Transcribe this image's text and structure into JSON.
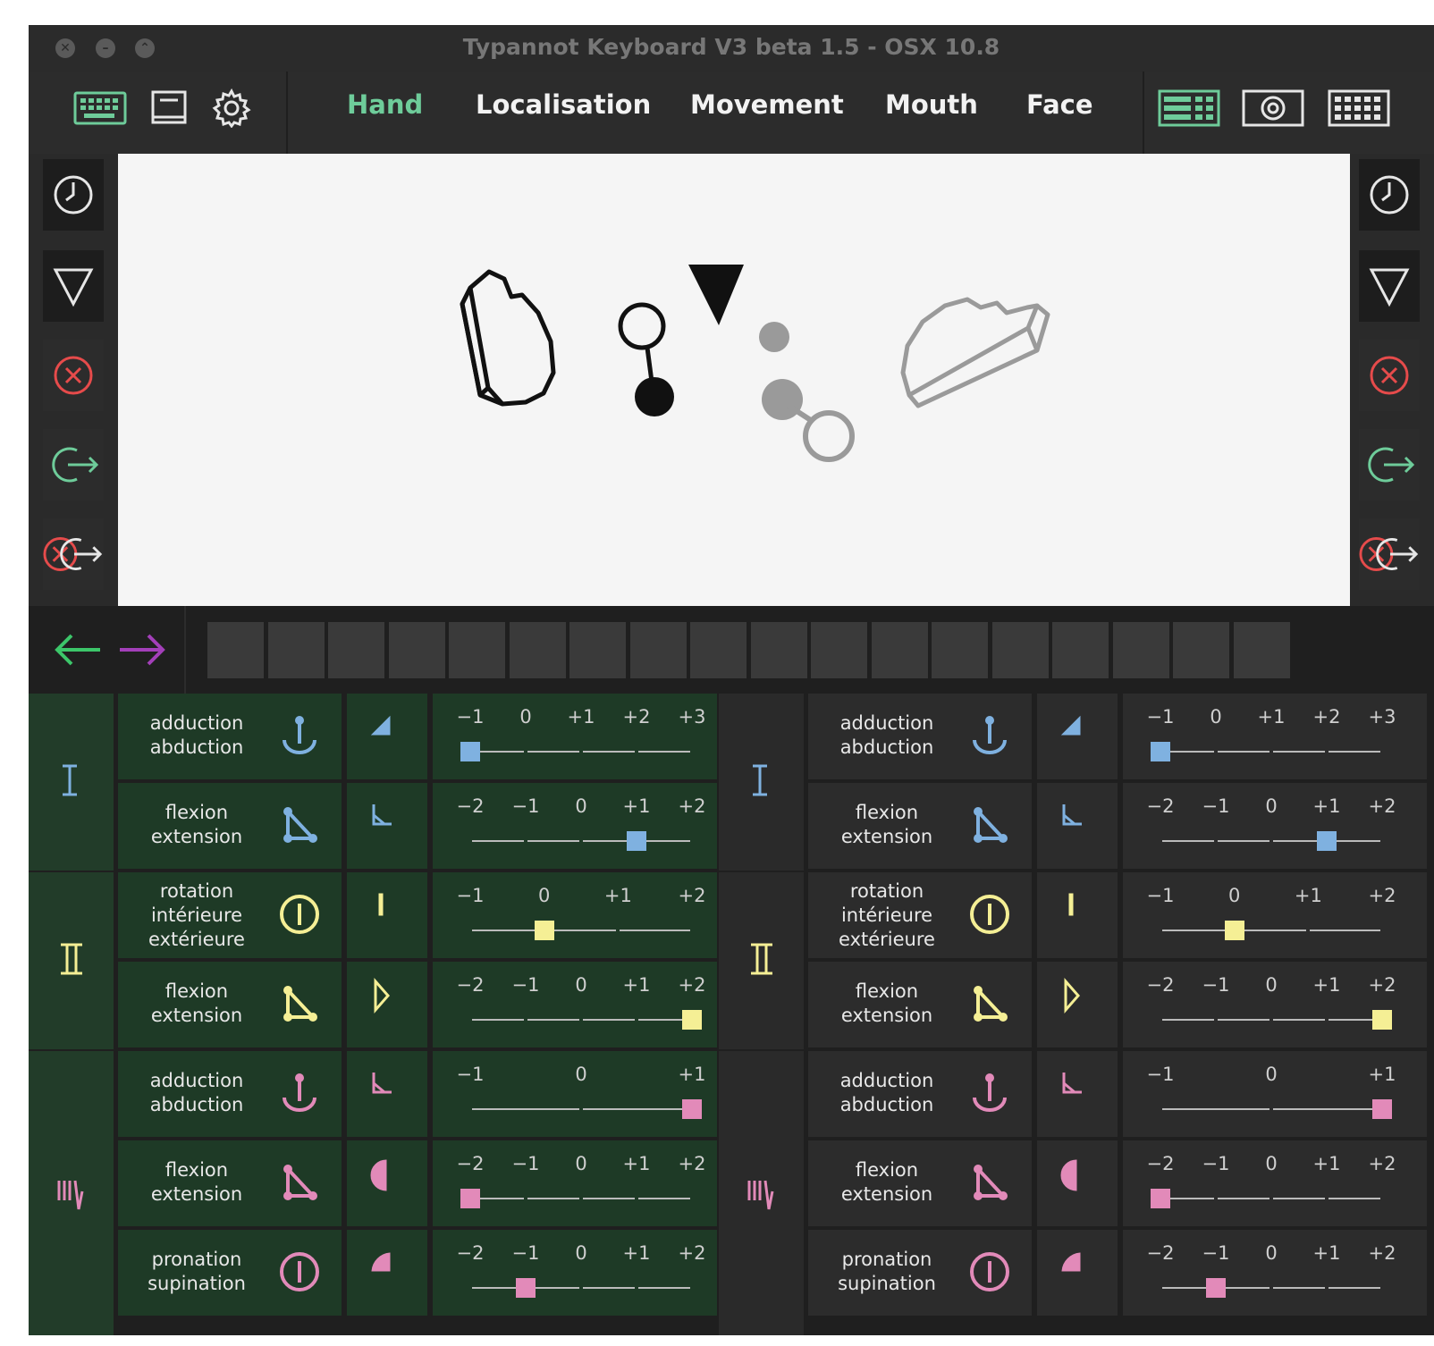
{
  "window": {
    "title": "Typannot Keyboard V3 beta 1.5 - OSX 10.8"
  },
  "traffic_lights": [
    {
      "name": "close",
      "glyph": "✕"
    },
    {
      "name": "minimize",
      "glyph": "–"
    },
    {
      "name": "zoom",
      "glyph": "⌃"
    }
  ],
  "toolbar": {
    "left_icons": [
      "keyboard-icon",
      "book-icon",
      "gear-icon"
    ],
    "tabs": [
      {
        "label": "Hand",
        "active": true
      },
      {
        "label": "Localisation",
        "active": false
      },
      {
        "label": "Movement",
        "active": false
      },
      {
        "label": "Mouth",
        "active": false
      },
      {
        "label": "Face",
        "active": false
      }
    ],
    "right_icons": [
      "layout-icon",
      "target-icon",
      "grid-keyboard-icon"
    ]
  },
  "side_buttons": [
    "clock-icon",
    "triangle-down-icon",
    "cancel-icon",
    "exit-icon",
    "cancel-exit-icon"
  ],
  "nav": {
    "back": "back-arrow-icon",
    "forward": "forward-arrow-icon",
    "sequence_slots": 18
  },
  "colors": {
    "accent": "#6ecc9a",
    "blue": "#7fb1e0",
    "yellow": "#f5ef95",
    "pink": "#e28ab9",
    "green_bg": "#223c29",
    "dark_bg": "#2a2a2a",
    "active_cell": "#1e3a26",
    "cell": "#2c2c2c"
  },
  "panels": [
    {
      "side": "left",
      "groups": [
        {
          "roman": "I",
          "rows": [
            {
              "label": [
                "adduction",
                "abduction"
              ],
              "color": "blue",
              "ticks": [
                "−1",
                "0",
                "+1",
                "+2",
                "+3"
              ],
              "value_index": 0
            },
            {
              "label": [
                "flexion",
                "extension"
              ],
              "color": "blue",
              "ticks": [
                "−2",
                "−1",
                "0",
                "+1",
                "+2"
              ],
              "value_index": 3
            }
          ]
        },
        {
          "roman": "II",
          "rows": [
            {
              "label": [
                "rotation",
                "intérieure",
                "extérieure"
              ],
              "color": "yellow",
              "ticks": [
                "−1",
                "0",
                "+1",
                "+2"
              ],
              "value_index": 1
            },
            {
              "label": [
                "flexion",
                "extension"
              ],
              "color": "yellow",
              "ticks": [
                "−2",
                "−1",
                "0",
                "+1",
                "+2"
              ],
              "value_index": 4
            }
          ]
        },
        {
          "roman": "III",
          "rows": [
            {
              "label": [
                "adduction",
                "abduction"
              ],
              "color": "pink",
              "ticks": [
                "−1",
                "0",
                "+1"
              ],
              "value_index": 2
            },
            {
              "label": [
                "flexion",
                "extension"
              ],
              "color": "pink",
              "ticks": [
                "−2",
                "−1",
                "0",
                "+1",
                "+2"
              ],
              "value_index": 0
            },
            {
              "label": [
                "pronation",
                "supination"
              ],
              "color": "pink",
              "ticks": [
                "−2",
                "−1",
                "0",
                "+1",
                "+2"
              ],
              "value_index": 1
            }
          ]
        }
      ]
    },
    {
      "side": "right",
      "groups": [
        {
          "roman": "I",
          "rows": [
            {
              "label": [
                "adduction",
                "abduction"
              ],
              "color": "blue",
              "ticks": [
                "−1",
                "0",
                "+1",
                "+2",
                "+3"
              ],
              "value_index": 0
            },
            {
              "label": [
                "flexion",
                "extension"
              ],
              "color": "blue",
              "ticks": [
                "−2",
                "−1",
                "0",
                "+1",
                "+2"
              ],
              "value_index": 3
            }
          ]
        },
        {
          "roman": "II",
          "rows": [
            {
              "label": [
                "rotation",
                "intérieure",
                "extérieure"
              ],
              "color": "yellow",
              "ticks": [
                "−1",
                "0",
                "+1",
                "+2"
              ],
              "value_index": 1
            },
            {
              "label": [
                "flexion",
                "extension"
              ],
              "color": "yellow",
              "ticks": [
                "−2",
                "−1",
                "0",
                "+1",
                "+2"
              ],
              "value_index": 4
            }
          ]
        },
        {
          "roman": "III",
          "rows": [
            {
              "label": [
                "adduction",
                "abduction"
              ],
              "color": "pink",
              "ticks": [
                "−1",
                "0",
                "+1"
              ],
              "value_index": 2
            },
            {
              "label": [
                "flexion",
                "extension"
              ],
              "color": "pink",
              "ticks": [
                "−2",
                "−1",
                "0",
                "+1",
                "+2"
              ],
              "value_index": 0
            },
            {
              "label": [
                "pronation",
                "supination"
              ],
              "color": "pink",
              "ticks": [
                "−2",
                "−1",
                "0",
                "+1",
                "+2"
              ],
              "value_index": 1
            }
          ]
        }
      ]
    }
  ]
}
